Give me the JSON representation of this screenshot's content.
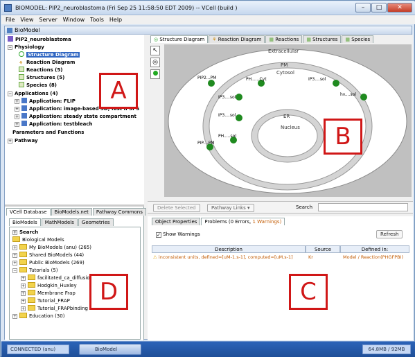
{
  "window": {
    "title": "BIOMODEL: PIP2_neuroblastoma (Fri Sep 25 11:58:50 EDT 2009) -- VCell (build )"
  },
  "menu": [
    "File",
    "View",
    "Server",
    "Window",
    "Tools",
    "Help"
  ],
  "inner_title": "BioModel",
  "tree": {
    "root": "PIP2_neuroblastoma",
    "physiology": "Physiology",
    "structure_diagram": "Structure Diagram",
    "reaction_diagram": "Reaction Diagram",
    "reactions": "Reactions (5)",
    "structures": "Structures (5)",
    "species": "Species (8)",
    "applications": "Applications (4)",
    "app1": "Application: FLIP",
    "app2": "Application: image-based 3D, fast IP3PS",
    "app3": "Application: steady state compartment",
    "app4": "Application: testbleach",
    "params": "Parameters and Functions",
    "pathway": "Pathway"
  },
  "db_tabs": [
    "VCell Database",
    "BioModels.net",
    "Pathway Commons"
  ],
  "db_subtabs": [
    "BioModels",
    "MathModels",
    "Geometries"
  ],
  "db_tree": {
    "search": "Search",
    "bio_models": "Biological Models",
    "my": "My BioModels (anu) (265)",
    "shared": "Shared BioModels (44)",
    "public": "Public BioModels (269)",
    "tutorials": "Tutorials (5)",
    "t1": "facilitated_ca_diffusion",
    "t2": "Hodgkin_Huxley",
    "t3": "Membrane Frap",
    "t4": "Tutorial_FRAP",
    "t5": "Tutorial_FRAPbinding",
    "education": "Education (30)"
  },
  "diagram_tabs": [
    "Structure Diagram",
    "Reaction Diagram",
    "Reactions",
    "Structures",
    "Species"
  ],
  "diagram": {
    "extracellular": "Extracellular",
    "pm": "PM",
    "cytosol": "Cytosol",
    "er": "ER",
    "nucleus": "Nucleus",
    "sp1": "PIP2...PM",
    "sp2": "IP3....sol",
    "sp3": "PH......Cyt",
    "sp4": "IP3....sol",
    "sp5": "hv....sol",
    "sp6": "IP3....sol",
    "sp7": "PIP....PM",
    "sp8": "PH.....sol"
  },
  "toolbar": {
    "delete": "Delete Selected",
    "pathway_links": "Pathway Links",
    "search": "Search"
  },
  "bottom_tabs": {
    "props": "Object Properties",
    "problems": "Problems (0 Errors, ",
    "warnings": "1 Warnings)"
  },
  "show_warnings": "Show Warnings",
  "refresh": "Refresh",
  "table": {
    "headers": [
      "Description",
      "Source",
      "Defined In:"
    ],
    "row": [
      "inconsistent units, defined=[uM-1.s-1], computed=[uM.s-1]",
      "Kr",
      "Model / Reaction(PHGFPBI)"
    ]
  },
  "status": {
    "conn": "CONNECTED (anu)",
    "task": "BioModel",
    "mem": "64.8MB / 92MB"
  },
  "labels": {
    "a": "A",
    "b": "B",
    "c": "C",
    "d": "D"
  },
  "colors": {
    "selection": "#3167c2",
    "warning": "#c25a00",
    "annotation": "#d01717",
    "species": "#1f8a1f"
  }
}
